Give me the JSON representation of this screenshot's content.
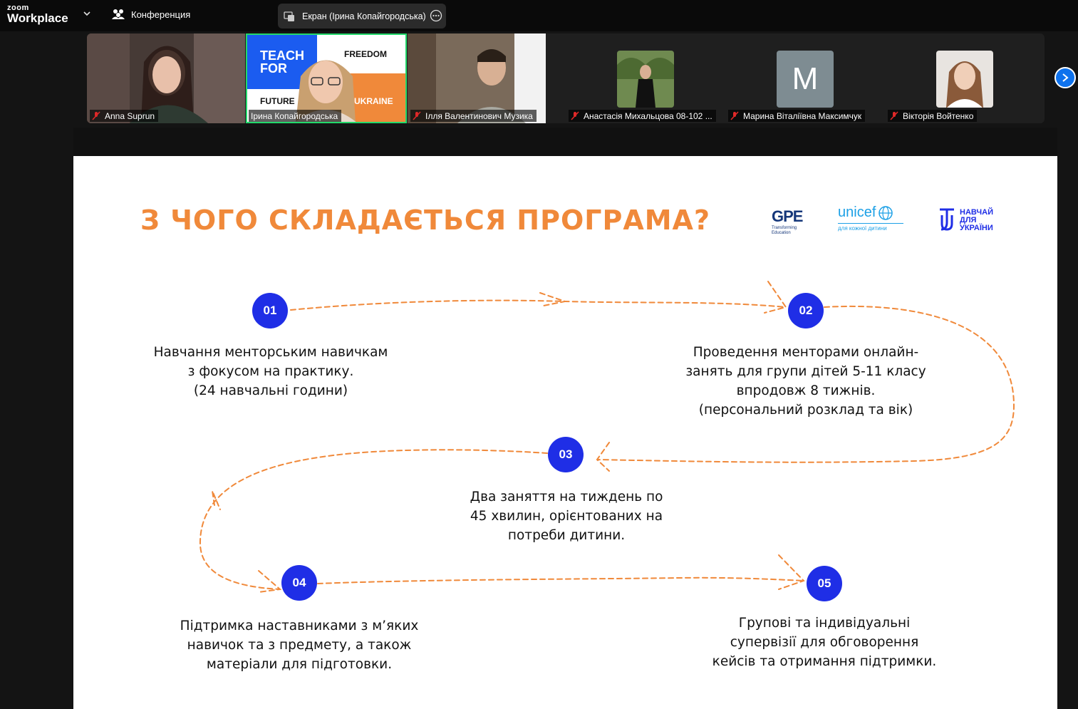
{
  "app": {
    "brand_top": "zoom",
    "brand_bottom": "Workplace",
    "meeting_label": "Конференция",
    "screen_share_label": "Екран (Ірина Копайгородська)"
  },
  "participants": [
    {
      "name": "Anna Suprun"
    },
    {
      "name": "Ірина Копайгородська",
      "poster_text": [
        "TEACH FOR",
        "FREEDOM",
        "FUTURE",
        "UKRAINE"
      ]
    },
    {
      "name": "Ілля Валентинович Музика"
    },
    {
      "name": "Анастасія Михальцова 08-102 ..."
    },
    {
      "name": "Марина Віталіївна Максимчук",
      "avatar_letter": "M"
    },
    {
      "name": "Вікторія Войтенко"
    }
  ],
  "slide": {
    "title": "З ЧОГО СКЛАДАЄТЬСЯ ПРОГРАМА?",
    "partners": {
      "gpe": "GPE",
      "gpe_sub": "Transforming Education",
      "unicef": "unicef",
      "unicef_sub": "для кожної дитини",
      "teach_ukraine": "НАВЧАЙ ДЛЯ УКРАЇНИ"
    },
    "steps": [
      {
        "num": "01",
        "lines": [
          "Навчання менторським навичкам",
          "з фокусом на практику.",
          "(24 навчальні години)"
        ]
      },
      {
        "num": "02",
        "lines": [
          "Проведення менторами онлайн-",
          "занять для групи дітей 5-11 класу",
          "впродовж 8 тижнів.",
          "(персональний розклад та вік)"
        ]
      },
      {
        "num": "03",
        "lines": [
          "Два заняття на тиждень по",
          "45 хвилин, орієнтованих на",
          "потреби дитини."
        ]
      },
      {
        "num": "04",
        "lines": [
          "Підтримка наставниками з м’яких",
          "навичок та з предмету, а також",
          "матеріали для підготовки."
        ]
      },
      {
        "num": "05",
        "lines": [
          "Групові та індивідуальні",
          "супервізії для обговорення",
          "кейсів та отримання підтримки."
        ]
      }
    ]
  },
  "colors": {
    "accent_orange": "#f0893a",
    "step_blue": "#1f2ee6",
    "active_speaker": "#23d96b",
    "zoom_blue": "#0e72ed"
  }
}
